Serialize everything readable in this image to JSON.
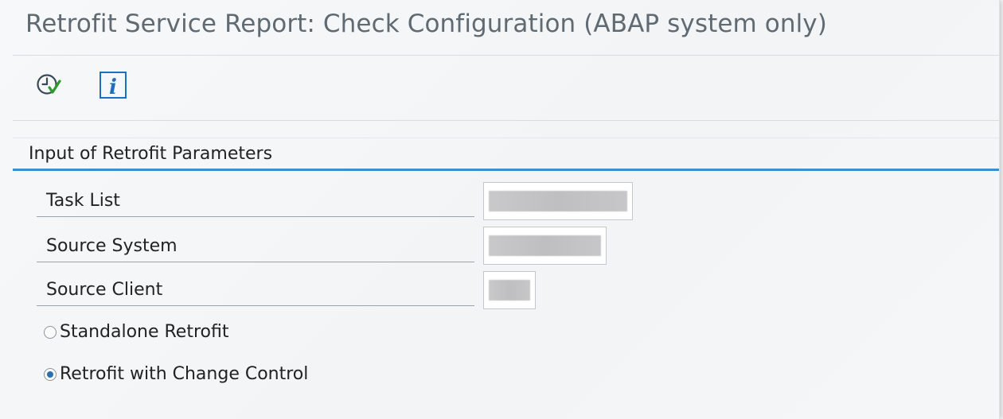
{
  "window": {
    "title": "Retrofit Service Report: Check Configuration (ABAP system only)"
  },
  "toolbar": {
    "execute_icon": "execute-clock-check-icon",
    "info_icon": "info-icon"
  },
  "group": {
    "title": "Input of Retrofit Parameters"
  },
  "fields": [
    {
      "label": "Task List"
    },
    {
      "label": "Source System"
    },
    {
      "label": "Source Client"
    }
  ],
  "options": [
    {
      "label": "Standalone Retrofit",
      "selected": false
    },
    {
      "label": "Retrofit with Change Control",
      "selected": true
    }
  ],
  "colors": {
    "accent": "#3a8fd0",
    "title_text": "#5f6a73",
    "execute_green": "#2e9a2e",
    "info_blue": "#1e6fc0"
  }
}
